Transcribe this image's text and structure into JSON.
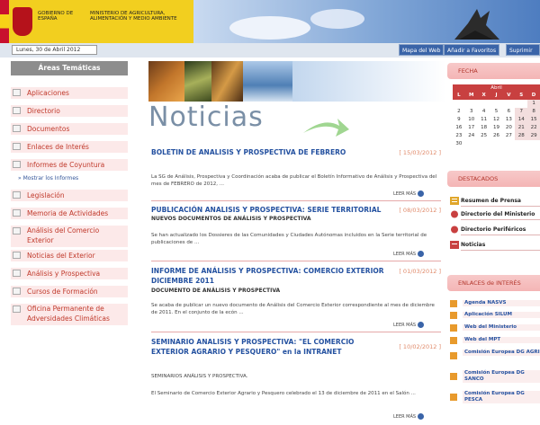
{
  "header": {
    "gobierno": "GOBIERNO DE ESPAÑA",
    "ministerio": "MINISTERIO DE AGRICULTURA, ALIMENTACIÓN Y MEDIO AMBIENTE",
    "date": "Lunes, 30 de Abril 2012",
    "links": [
      "Mapa del Web",
      "Añadir a Favoritos",
      "Suprimir"
    ]
  },
  "sidebar": {
    "title": "Áreas Temáticas",
    "items": [
      {
        "label": "Aplicaciones"
      },
      {
        "label": "Directorio"
      },
      {
        "label": "Documentos"
      },
      {
        "label": "Enlaces de Interés"
      },
      {
        "label": "Informes de Coyuntura"
      },
      {
        "label": "Legislación"
      },
      {
        "label": "Memoria de Actividades"
      },
      {
        "label": "Análisis del Comercio Exterior"
      },
      {
        "label": "Noticias del Exterior"
      },
      {
        "label": "Análisis y Prospectiva"
      },
      {
        "label": "Cursos de Formación"
      },
      {
        "label": "Oficina Permanente de Adversidades Climáticas"
      }
    ],
    "sub_link": "» Mostrar los Informes"
  },
  "main": {
    "heading": "Noticias",
    "news": [
      {
        "title": "BOLETIN DE ANALISIS Y PROSPECTIVA DE FEBRERO",
        "date": "[ 15/03/2012 ]",
        "subtitle": "",
        "body": "La SG de Análisis, Prospectiva y Coordinación acaba de publicar el Boletín Informativo de Análisis y Prospectiva del mes de FEBRERO de 2012, ...",
        "more": "LEER MÁS"
      },
      {
        "title": "PUBLICACIÓN ANALISIS Y PROSPECTIVA: SERIE TERRITORIAL",
        "date": "[ 08/03/2012 ]",
        "subtitle": "NUEVOS DOCUMENTOS DE ANÁLISIS Y PROSPECTIVA",
        "body": "Se han actualizado los Dossieres de las Comunidades y Ciudades Autónomas incluidos en la Serie territorial de publicaciones de ...",
        "more": "LEER MÁS"
      },
      {
        "title": "INFORME DE ANÁLISIS Y PROSPECTIVA: COMERCIO EXTERIOR DICIEMBRE 2011",
        "date": "[ 01/03/2012 ]",
        "subtitle": "DOCUMENTO DE ANÁLISIS Y PROSPECTIVA",
        "body": "Se acaba de publicar un nuevo documento de Análisis del Comercio Exterior correspondiente al mes de diciembre de 2011. En el conjunto de la ecón ...",
        "more": "LEER MÁS"
      },
      {
        "title": "SEMINARIO ANALISIS Y PROSPECTIVA: \"EL COMERCIO EXTERIOR AGRARIO Y PESQUERO\" en la INTRANET",
        "date": "[ 10/02/2012 ]",
        "subtitle": "SEMINARIOS ANÁLISIS Y PROSPECTIVA.",
        "body": "El Seminario de Comercio Exterior Agrario y Pesquero celebrado el 13 de diciembre de 2011 en el Salón ...",
        "more": "LEER MÁS"
      }
    ]
  },
  "right": {
    "fecha_title": "FECHA",
    "calendar": {
      "month": "Abril",
      "days_header": [
        "L",
        "M",
        "X",
        "J",
        "V",
        "S",
        "D"
      ],
      "weeks": [
        [
          "",
          "",
          "",
          "",
          "",
          "",
          "1"
        ],
        [
          "2",
          "3",
          "4",
          "5",
          "6",
          "7",
          "8"
        ],
        [
          "9",
          "10",
          "11",
          "12",
          "13",
          "14",
          "15"
        ],
        [
          "16",
          "17",
          "18",
          "19",
          "20",
          "21",
          "22"
        ],
        [
          "23",
          "24",
          "25",
          "26",
          "27",
          "28",
          "29"
        ],
        [
          "30",
          "",
          "",
          "",
          "",
          "",
          ""
        ]
      ]
    },
    "destacados_title": "DESTACADOS",
    "destacados": [
      "Resumen de Prensa",
      "Directorio del Ministerio",
      "Directorio Periféricos",
      "Noticias"
    ],
    "enlaces_title": "ENLACES de INTERÉS",
    "enlaces": [
      "Agenda NASVS",
      "Aplicación SILUM",
      "Web del Ministerio",
      "Web del MPT",
      "Comisión Europea DG AGRI",
      "Comisión Europea DG SANCO",
      "Comisión Europea DG PESCA"
    ]
  },
  "colors": {
    "accent_red": "#c84040",
    "link_blue": "#2451a0",
    "header_yellow": "#f2cf1f"
  }
}
